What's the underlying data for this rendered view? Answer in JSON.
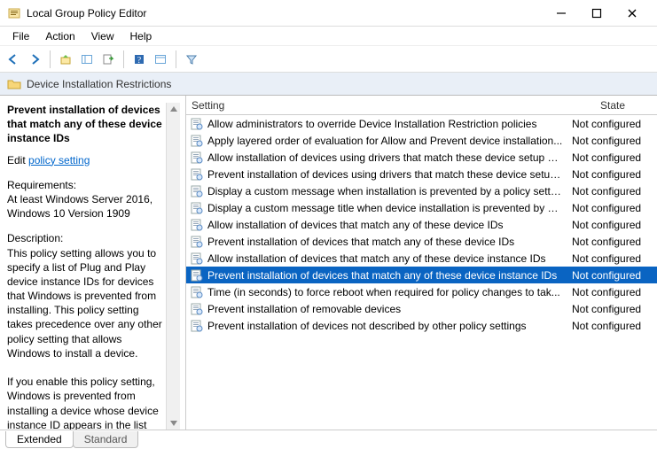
{
  "window": {
    "title": "Local Group Policy Editor"
  },
  "menu": {
    "file": "File",
    "action": "Action",
    "view": "View",
    "help": "Help"
  },
  "folderbar": {
    "label": "Device Installation Restrictions"
  },
  "detail": {
    "title": "Prevent installation of devices that match any of these device instance IDs",
    "edit_prefix": "Edit",
    "edit_link": "policy setting",
    "req_label": "Requirements:",
    "req_body": "At least Windows Server 2016, Windows 10 Version 1909",
    "desc_label": "Description:",
    "desc_body": "This policy setting allows you to specify a list of Plug and Play device instance IDs for devices that Windows is prevented from installing. This policy setting takes precedence over any other policy setting that allows Windows to install a device.\n\nIf you enable this policy setting, Windows is prevented from installing a device whose device instance ID appears in the list you"
  },
  "columns": {
    "setting": "Setting",
    "state": "State"
  },
  "rows": [
    {
      "name": "Allow administrators to override Device Installation Restriction policies",
      "state": "Not configured",
      "selected": false
    },
    {
      "name": "Apply layered order of evaluation for Allow and Prevent device installation...",
      "state": "Not configured",
      "selected": false
    },
    {
      "name": "Allow installation of devices using drivers that match these device setup cl...",
      "state": "Not configured",
      "selected": false
    },
    {
      "name": "Prevent installation of devices using drivers that match these device setup ...",
      "state": "Not configured",
      "selected": false
    },
    {
      "name": "Display a custom message when installation is prevented by a policy setting",
      "state": "Not configured",
      "selected": false
    },
    {
      "name": "Display a custom message title when device installation is prevented by a ...",
      "state": "Not configured",
      "selected": false
    },
    {
      "name": "Allow installation of devices that match any of these device IDs",
      "state": "Not configured",
      "selected": false
    },
    {
      "name": "Prevent installation of devices that match any of these device IDs",
      "state": "Not configured",
      "selected": false
    },
    {
      "name": "Allow installation of devices that match any of these device instance IDs",
      "state": "Not configured",
      "selected": false
    },
    {
      "name": "Prevent installation of devices that match any of these device instance IDs",
      "state": "Not configured",
      "selected": true
    },
    {
      "name": "Time (in seconds) to force reboot when required for policy changes to tak...",
      "state": "Not configured",
      "selected": false
    },
    {
      "name": "Prevent installation of removable devices",
      "state": "Not configured",
      "selected": false
    },
    {
      "name": "Prevent installation of devices not described by other policy settings",
      "state": "Not configured",
      "selected": false
    }
  ],
  "tabs": {
    "extended": "Extended",
    "standard": "Standard"
  }
}
